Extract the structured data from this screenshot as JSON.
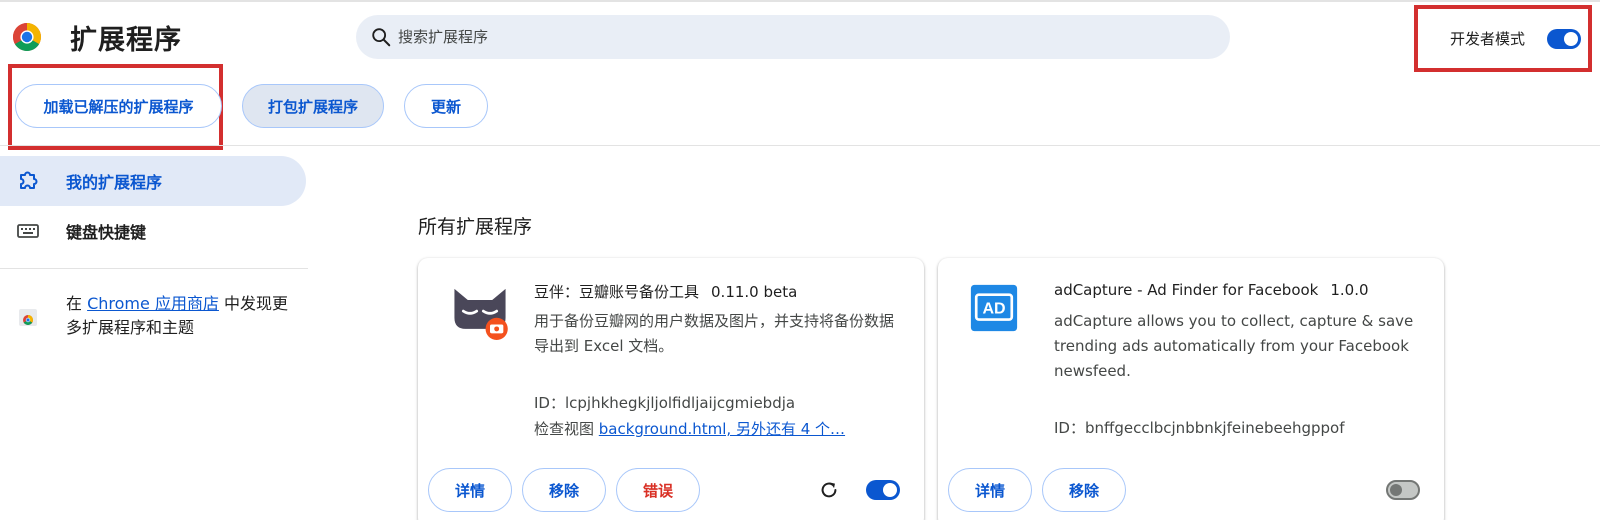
{
  "header": {
    "title": "扩展程序",
    "search_placeholder": "搜索扩展程序",
    "dev_mode_label": "开发者模式",
    "dev_mode_on": true
  },
  "toolbar": {
    "load_unpacked": "加载已解压的扩展程序",
    "pack": "打包扩展程序",
    "update": "更新"
  },
  "sidebar": {
    "items": [
      {
        "label": "我的扩展程序",
        "icon": "puzzle-icon",
        "active": true
      },
      {
        "label": "键盘快捷键",
        "icon": "keyboard-icon",
        "active": false
      }
    ],
    "store_prefix": "在 ",
    "store_link": "Chrome 应用商店",
    "store_suffix": " 中发现更多扩展程序和主题"
  },
  "main": {
    "section_title": "所有扩展程序",
    "extensions": [
      {
        "name": "豆伴：豆瓣账号备份工具",
        "version": "0.11.0 beta",
        "description": "用于备份豆瓣网的用户数据及图片，并支持将备份数据导出到 Excel 文档。",
        "id": "ID：lcpjhkhegkjljolfidljaijcgmiebdja",
        "views_label": "检查视图 ",
        "views_link": "background.html, 另外还有 4 个…",
        "details": "详情",
        "remove": "移除",
        "errors": "错误",
        "enabled": true
      },
      {
        "name": "adCapture - Ad Finder for Facebook",
        "version": "1.0.0",
        "description": "adCapture allows you to collect, capture & save trending ads automatically from your Facebook newsfeed.",
        "id": "ID：bnffgecclbcjnbbnkjfeinebeehgppof",
        "details": "详情",
        "remove": "移除",
        "enabled": false
      }
    ]
  },
  "colors": {
    "accent": "#0b57d0",
    "highlight": "#d32f2f",
    "error": "#d93025"
  }
}
